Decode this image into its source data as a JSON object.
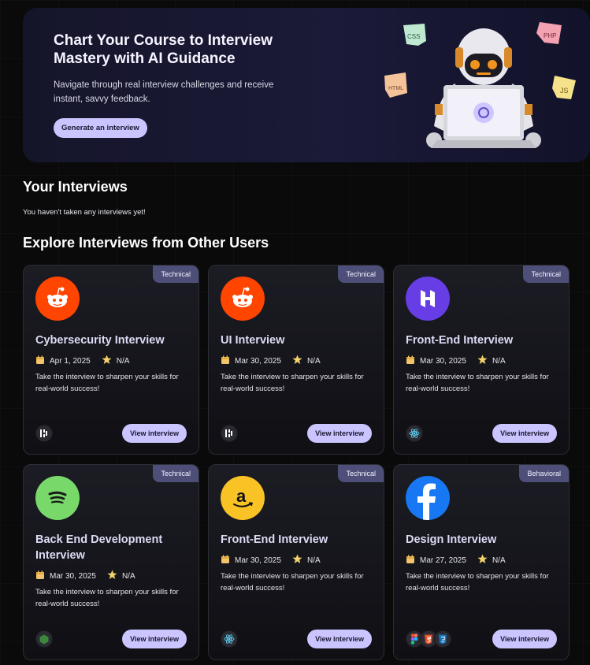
{
  "hero": {
    "title": "Chart Your Course to Interview Mastery with AI Guidance",
    "subtitle": "Navigate through real interview challenges and receive instant, savvy feedback.",
    "button": "Generate an interview",
    "stickers": [
      "CSS",
      "PHP",
      "HTML",
      "JS"
    ]
  },
  "your_interviews": {
    "title": "Your Interviews",
    "empty": "You haven't taken any interviews yet!"
  },
  "explore": {
    "title": "Explore Interviews from Other Users",
    "cards": [
      {
        "badge": "Technical",
        "title": "Cybersecurity Interview",
        "date": "Apr 1, 2025",
        "score": "N/A",
        "desc": "Take the interview to sharpen your skills for real-world success!",
        "button": "View interview",
        "logo": "reddit-logo",
        "logo_color": "#ff4500",
        "tech": [
          "nextjs-icon"
        ]
      },
      {
        "badge": "Technical",
        "title": "UI Interview",
        "date": "Mar 30, 2025",
        "score": "N/A",
        "desc": "Take the interview to sharpen your skills for real-world success!",
        "button": "View interview",
        "logo": "reddit-logo",
        "logo_color": "#ff4500",
        "tech": [
          "nextjs-icon"
        ]
      },
      {
        "badge": "Technical",
        "title": "Front-End Interview",
        "date": "Mar 30, 2025",
        "score": "N/A",
        "desc": "Take the interview to sharpen your skills for real-world success!",
        "button": "View interview",
        "logo": "hostinger-logo",
        "logo_color": "#673de6",
        "tech": [
          "react-icon"
        ]
      },
      {
        "badge": "Technical",
        "title": "Back End Development Interview",
        "date": "Mar 30, 2025",
        "score": "N/A",
        "desc": "Take the interview to sharpen your skills for real-world success!",
        "button": "View interview",
        "logo": "spotify-logo",
        "logo_color": "#78d86a",
        "tech": [
          "nodejs-icon"
        ]
      },
      {
        "badge": "Technical",
        "title": "Front-End Interview",
        "date": "Mar 30, 2025",
        "score": "N/A",
        "desc": "Take the interview to sharpen your skills for real-world success!",
        "button": "View interview",
        "logo": "amazon-logo",
        "logo_color": "#f9c225",
        "tech": [
          "react-icon"
        ]
      },
      {
        "badge": "Behavioral",
        "title": "Design Interview",
        "date": "Mar 27, 2025",
        "score": "N/A",
        "desc": "Take the interview to sharpen your skills for real-world success!",
        "button": "View interview",
        "logo": "facebook-logo",
        "logo_color": "#1877f2",
        "tech": [
          "figma-icon",
          "html5-icon",
          "css3-icon"
        ]
      }
    ]
  }
}
